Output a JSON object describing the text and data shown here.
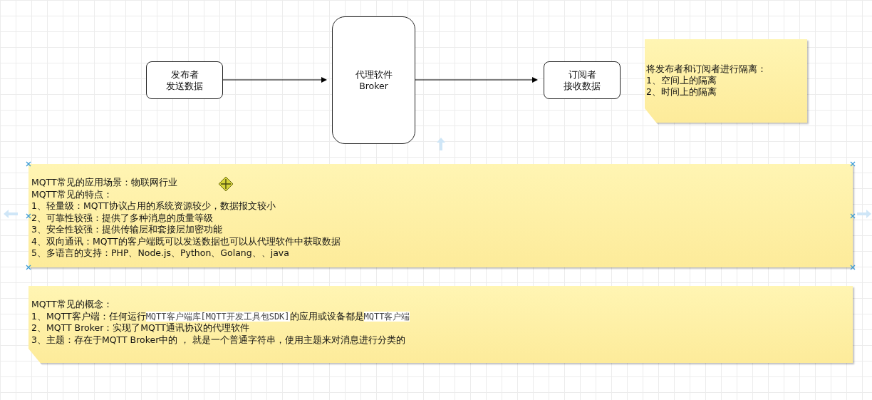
{
  "diagram": {
    "nodes": [
      {
        "kind": "box",
        "lines": [
          "发布者",
          "发送数据"
        ]
      },
      {
        "kind": "tall",
        "lines": [
          "代理软件",
          "Broker"
        ]
      },
      {
        "kind": "box",
        "lines": [
          "订阅者",
          "接收数据"
        ]
      }
    ],
    "note_top": {
      "lines": [
        "将发布者和订阅者进行隔离：",
        "1、空间上的隔离",
        "2、时间上的隔离"
      ]
    },
    "notes": [
      {
        "selected": true,
        "lines": [
          [
            {
              "kind": "plain",
              "text": "MQTT常见的应用场景：物联网行业"
            }
          ],
          [
            {
              "kind": "plain",
              "text": "MQTT常见的特点："
            }
          ],
          [
            {
              "kind": "plain",
              "text": "1、轻量级：MQTT协议占用的系统资源较少，数据报文较小"
            }
          ],
          [
            {
              "kind": "plain",
              "text": "2、可靠性较强：提供了多种消息的质量等级"
            }
          ],
          [
            {
              "kind": "plain",
              "text": "3、安全性较强：提供传输层和套接层加密功能"
            }
          ],
          [
            {
              "kind": "plain",
              "text": "4、双向通讯：MQTT的客户端既可以发送数据也可以从代理软件中获取数据"
            }
          ],
          [
            {
              "kind": "plain",
              "text": "5、多语言的支持：PHP、Node.js、Python、Golang、、java"
            }
          ]
        ]
      },
      {
        "selected": false,
        "lines": [
          [
            {
              "kind": "plain",
              "text": "MQTT常见的概念："
            }
          ],
          [
            {
              "kind": "plain",
              "text": "1、MQTT客户端：任何运行"
            },
            {
              "kind": "code",
              "text": "MQTT客户端库[MQTT开发工具包SDK]"
            },
            {
              "kind": "plain",
              "text": "的应用或设备都是"
            },
            {
              "kind": "code",
              "text": "MQTT客户端"
            }
          ],
          [
            {
              "kind": "plain",
              "text": "2、MQTT Broker：实现了MQTT通讯协议的代理软件"
            }
          ],
          [
            {
              "kind": "plain",
              "text": "3、主题：存在于MQTT Broker中的 ， 就是一个普通字符串，使用主题来对消息进行分类的"
            }
          ]
        ]
      }
    ]
  }
}
